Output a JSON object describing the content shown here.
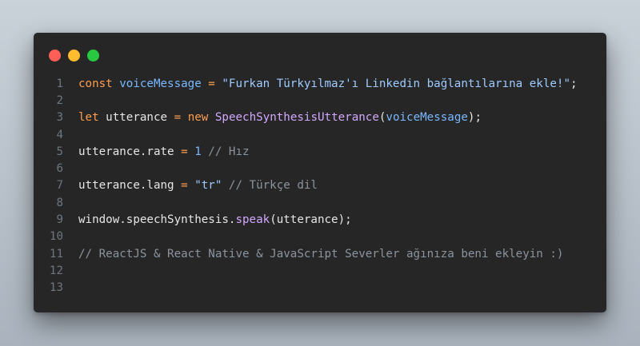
{
  "window": {
    "traffic_lights": [
      {
        "name": "close",
        "color": "#ff5f57"
      },
      {
        "name": "minimize",
        "color": "#febc2e"
      },
      {
        "name": "maximize",
        "color": "#28c840"
      }
    ]
  },
  "code": {
    "lines": [
      {
        "n": "1",
        "tokens": [
          {
            "t": "const",
            "c": "kw"
          },
          {
            "t": " ",
            "c": "plain"
          },
          {
            "t": "voiceMessage",
            "c": "var"
          },
          {
            "t": " = ",
            "c": "op"
          },
          {
            "t": "\"Furkan Türkyılmaz'ı Linkedin bağlantılarına ekle!\"",
            "c": "str"
          },
          {
            "t": ";",
            "c": "plain"
          }
        ]
      },
      {
        "n": "2",
        "tokens": []
      },
      {
        "n": "3",
        "tokens": [
          {
            "t": "let",
            "c": "kw"
          },
          {
            "t": " utterance ",
            "c": "plain"
          },
          {
            "t": "=",
            "c": "op"
          },
          {
            "t": " ",
            "c": "plain"
          },
          {
            "t": "new",
            "c": "kw"
          },
          {
            "t": " ",
            "c": "plain"
          },
          {
            "t": "SpeechSynthesisUtterance",
            "c": "fn"
          },
          {
            "t": "(",
            "c": "plain"
          },
          {
            "t": "voiceMessage",
            "c": "var"
          },
          {
            "t": ");",
            "c": "plain"
          }
        ]
      },
      {
        "n": "4",
        "tokens": []
      },
      {
        "n": "5",
        "tokens": [
          {
            "t": "utterance.rate ",
            "c": "plain"
          },
          {
            "t": "=",
            "c": "op"
          },
          {
            "t": " ",
            "c": "plain"
          },
          {
            "t": "1",
            "c": "num"
          },
          {
            "t": " // Hız",
            "c": "cm"
          }
        ]
      },
      {
        "n": "6",
        "tokens": []
      },
      {
        "n": "7",
        "tokens": [
          {
            "t": "utterance.lang ",
            "c": "plain"
          },
          {
            "t": "=",
            "c": "op"
          },
          {
            "t": " ",
            "c": "plain"
          },
          {
            "t": "\"tr\"",
            "c": "str"
          },
          {
            "t": " // Türkçe dil",
            "c": "cm"
          }
        ]
      },
      {
        "n": "8",
        "tokens": []
      },
      {
        "n": "9",
        "tokens": [
          {
            "t": "window.speechSynthesis.",
            "c": "plain"
          },
          {
            "t": "speak",
            "c": "fn"
          },
          {
            "t": "(utterance);",
            "c": "plain"
          }
        ]
      },
      {
        "n": "10",
        "tokens": []
      },
      {
        "n": "11",
        "tokens": [
          {
            "t": "// ReactJS & React Native & JavaScript Severler ağınıza beni ekleyin :)",
            "c": "cm"
          }
        ]
      },
      {
        "n": "12",
        "tokens": []
      },
      {
        "n": "13",
        "tokens": []
      }
    ]
  }
}
